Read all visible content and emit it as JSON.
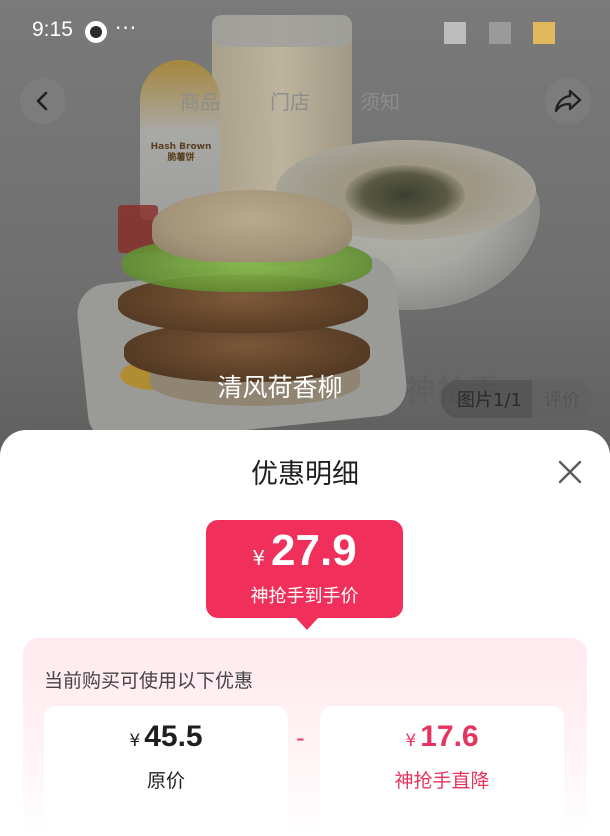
{
  "status_bar": {
    "time": "9:15",
    "dots": "···"
  },
  "nav": {
    "tabs": [
      "商品",
      "门店",
      "须知"
    ]
  },
  "product_image": {
    "name": "清风荷香柳",
    "counter": "图片1/1",
    "review_tab": "评价",
    "package_text": "Hash Brown\n脆薯饼"
  },
  "sheet": {
    "title": "优惠明细",
    "final_price": {
      "currency": "¥",
      "value": "27.9",
      "label": "神抢手到手价"
    },
    "discount_heading": "当前购买可使用以下优惠",
    "original": {
      "currency": "¥",
      "value": "45.5",
      "label": "原价"
    },
    "operator": "-",
    "reduction": {
      "currency": "¥",
      "value": "17.6",
      "label": "神抢手直降"
    }
  },
  "colors": {
    "accent": "#f0305a",
    "discount_text": "#e8335f"
  }
}
